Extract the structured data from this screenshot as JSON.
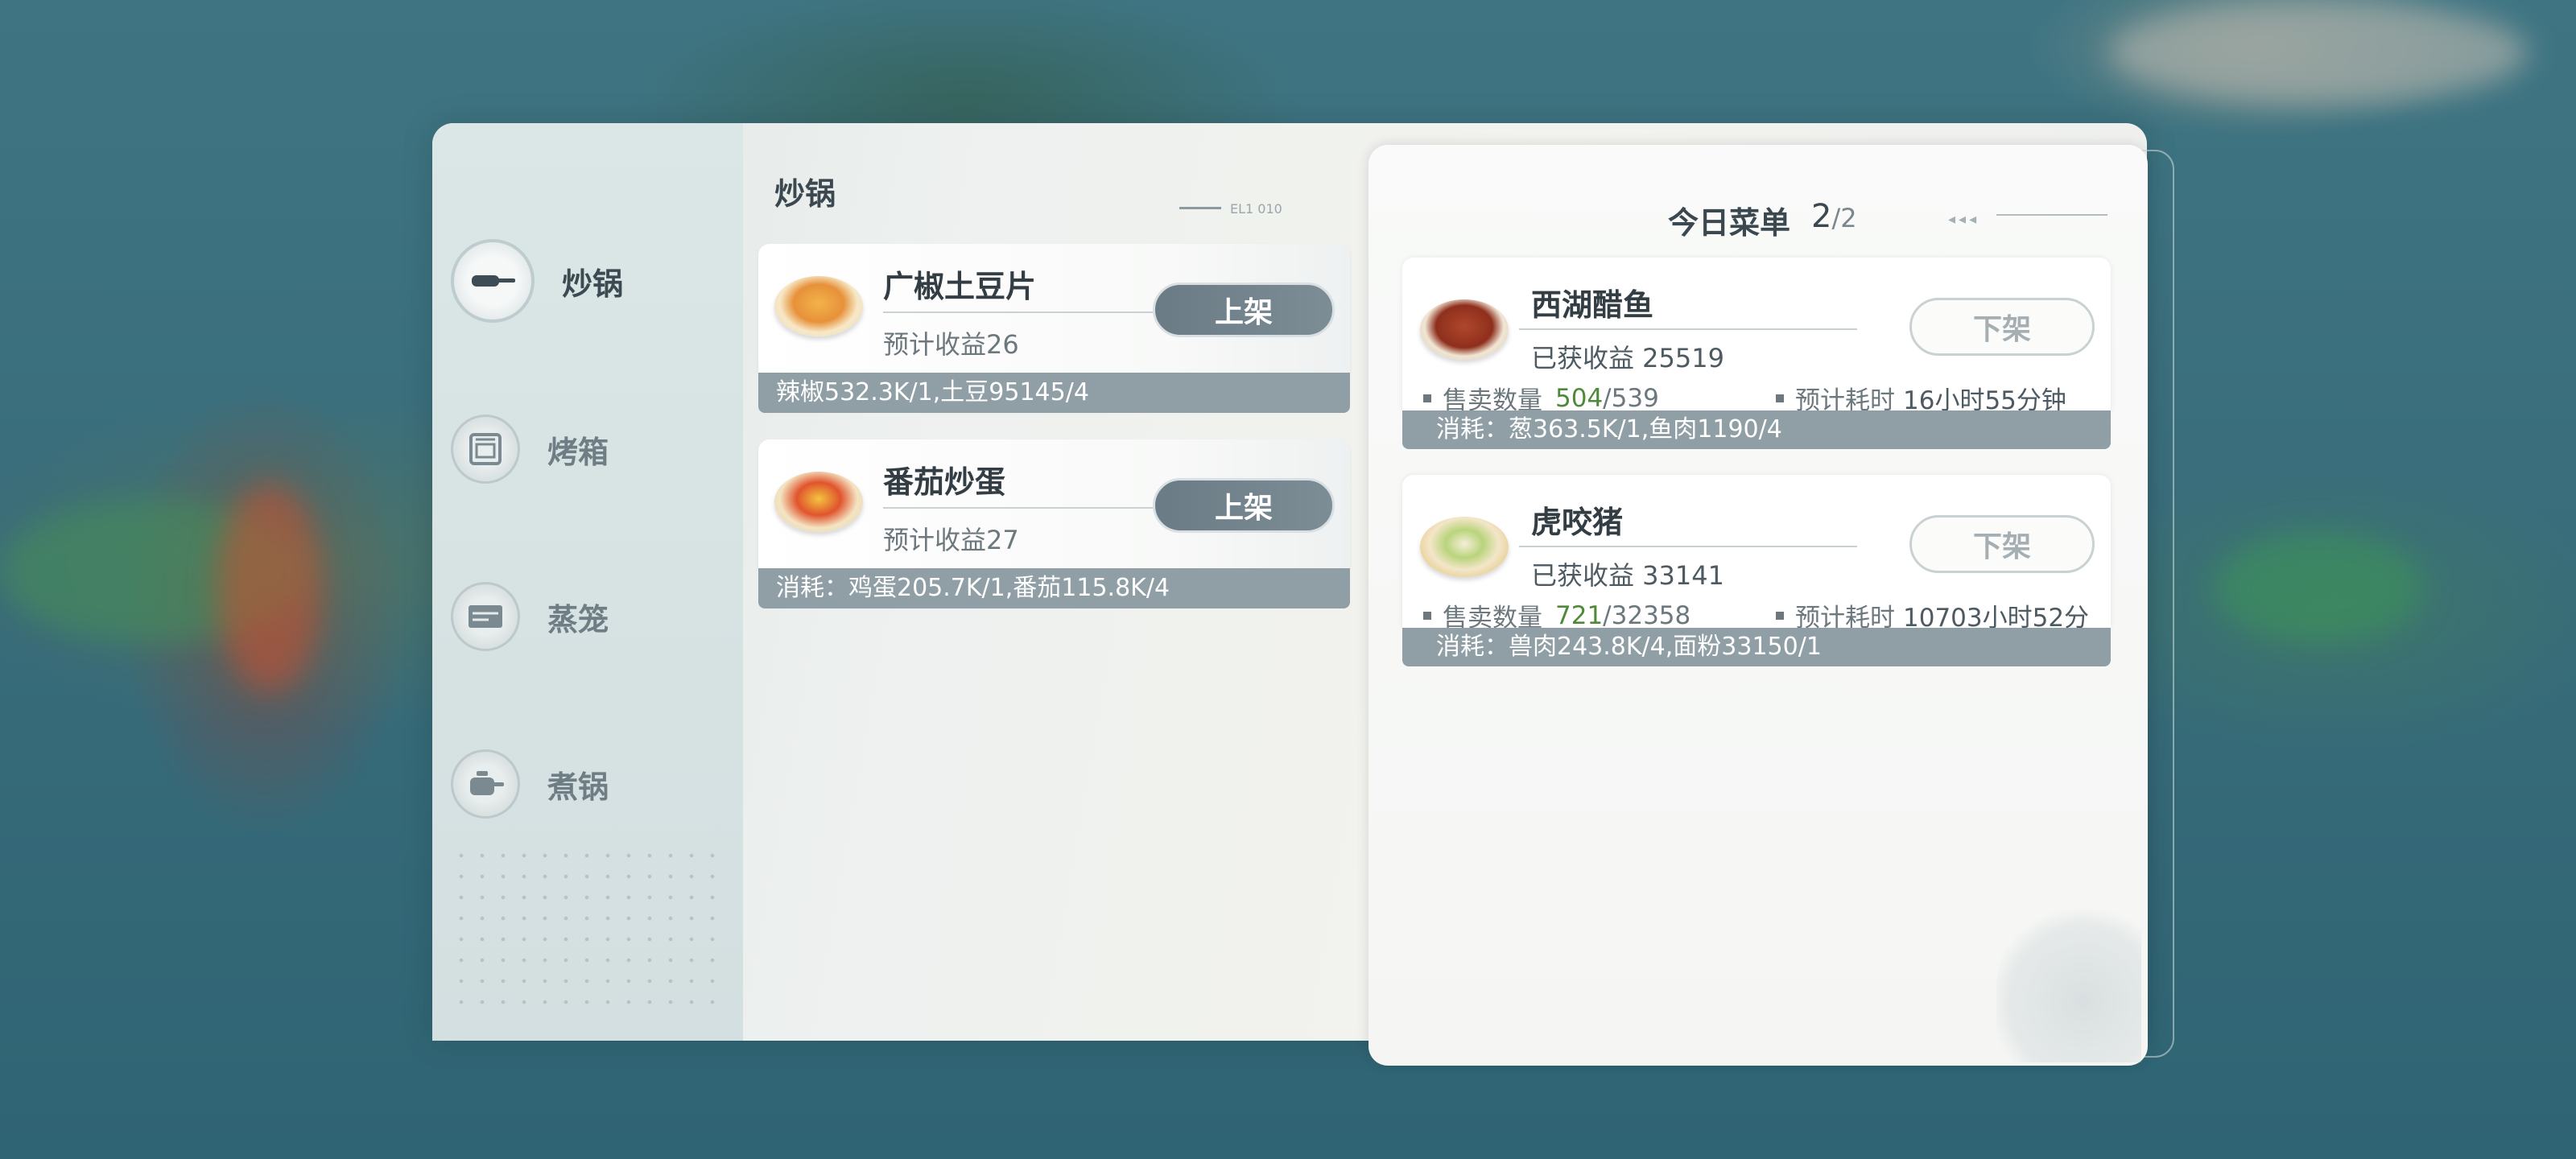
{
  "sidebar": {
    "items": [
      {
        "label": "炒锅",
        "icon": "wok-icon",
        "active": true
      },
      {
        "label": "烤箱",
        "icon": "oven-icon",
        "active": false
      },
      {
        "label": "蒸笼",
        "icon": "steamer-icon",
        "active": false
      },
      {
        "label": "煮锅",
        "icon": "pot-icon",
        "active": false
      }
    ]
  },
  "recipes": {
    "section_title": "炒锅",
    "deco_text": "EL1 010",
    "items": [
      {
        "name": "广椒土豆片",
        "income": "预计收益26",
        "button": "上架",
        "ingredients": "辣椒532.3K/1,土豆95145/4"
      },
      {
        "name": "番茄炒蛋",
        "income": "预计收益27",
        "button": "上架",
        "ingredients": "消耗：鸡蛋205.7K/1,番茄115.8K/4"
      }
    ]
  },
  "menu": {
    "title": "今日菜单",
    "count": "2",
    "total": "/2",
    "items": [
      {
        "name": "西湖醋鱼",
        "earned": "已获收益 25519",
        "sold_label": "售卖数量",
        "sold_now": "504",
        "sold_total": "/539",
        "time_label": "预计耗时",
        "time_value": "16小时55分钟",
        "button": "下架",
        "consumption": "消耗：葱363.5K/1,鱼肉1190/4"
      },
      {
        "name": "虎咬猪",
        "earned": "已获收益 33141",
        "sold_label": "售卖数量",
        "sold_now": "721",
        "sold_total": "/32358",
        "time_label": "预计耗时",
        "time_value": "10703小时52分",
        "button": "下架",
        "consumption": "消耗：兽肉243.8K/4,面粉33150/1"
      }
    ]
  },
  "colors": {
    "accent": "#6a7b85",
    "footer_bar": "#8f9fa5",
    "sold_green": "#4f8a3a"
  }
}
